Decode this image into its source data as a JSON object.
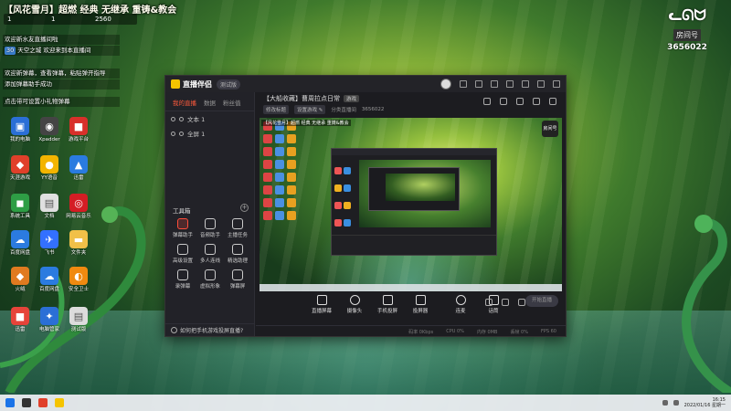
{
  "overlay": {
    "title": "【风花雪月】超燃 经典 无继承 重铸&教会",
    "stats": [
      "1",
      "1",
      "2560"
    ],
    "chat": [
      {
        "text": "欢迎新水友直播间啦",
        "badge": ""
      },
      {
        "text": "天空之城 欢迎来到本直播间",
        "badge": "30"
      },
      {
        "text": "欢迎新弹幕，查看弹幕，粘贴弹开指导",
        "badge": ""
      },
      {
        "text": "添加弹幕助手成功",
        "badge": ""
      },
      {
        "text": "点击带可设置小礼物弹幕",
        "badge": ""
      }
    ]
  },
  "room_logo": {
    "label": "房间号",
    "number": "3656022"
  },
  "desktop_icons": [
    {
      "label": "我的电脑",
      "color": "#2b6fd6",
      "glyph": "▣"
    },
    {
      "label": "Xpadder",
      "color": "#444444",
      "glyph": "◉"
    },
    {
      "label": "游戏平台",
      "color": "#d8302a",
      "glyph": "■"
    },
    {
      "label": "天涯游戏",
      "color": "#e0402a",
      "glyph": "◆"
    },
    {
      "label": "YY语音",
      "color": "#f3b400",
      "glyph": "●"
    },
    {
      "label": "迅雷",
      "color": "#2a7be0",
      "glyph": "▲"
    },
    {
      "label": "系统工具",
      "color": "#2e9e45",
      "glyph": "◼"
    },
    {
      "label": "文档",
      "color": "#e0e0e0",
      "glyph": "▤"
    },
    {
      "label": "网易云音乐",
      "color": "#d41d24",
      "glyph": "◎"
    },
    {
      "label": "百度网盘",
      "color": "#2b7be0",
      "glyph": "☁"
    },
    {
      "label": "飞书",
      "color": "#3370ff",
      "glyph": "✈"
    },
    {
      "label": "文件夹",
      "color": "#f1c048",
      "glyph": "▬"
    },
    {
      "label": "火绒",
      "color": "#e07a20",
      "glyph": "◆"
    },
    {
      "label": "百度网盘",
      "color": "#2b7be0",
      "glyph": "☁"
    },
    {
      "label": "安全卫士",
      "color": "#f08a10",
      "glyph": "◐"
    },
    {
      "label": "迅雷",
      "color": "#e6443a",
      "glyph": "■"
    },
    {
      "label": "电脑管家",
      "color": "#2b6fd6",
      "glyph": "✦"
    },
    {
      "label": "测试版",
      "color": "#dcdcdc",
      "glyph": "▤"
    }
  ],
  "app": {
    "name": "直播伴侣",
    "version": "测试版",
    "left_tabs": [
      "我的直播",
      "数据",
      "粉丝值"
    ],
    "scenes": [
      "文本 1",
      "全屏 1"
    ],
    "tools_title": "工具箱",
    "tools": [
      {
        "label": "弹幕助手",
        "red": true
      },
      {
        "label": "音频助手",
        "red": false
      },
      {
        "label": "主播任务",
        "red": false
      },
      {
        "label": "高级设置",
        "red": false
      },
      {
        "label": "多人连线",
        "red": false
      },
      {
        "label": "精选助理",
        "red": false
      },
      {
        "label": "录弹幕",
        "red": false
      },
      {
        "label": "虚拟形象",
        "red": false
      },
      {
        "label": "弹幕屏",
        "red": false
      }
    ],
    "footer_hint": "如何把手机游戏投屏直播?",
    "room_title": "【大船收藏】曹周拉点日常",
    "room_tag": "游戏",
    "room_sub": [
      "修改标题",
      "设置游戏 ✎",
      "分类直播间",
      "3656022"
    ],
    "controls": [
      "直播屏幕",
      "摄像头",
      "手机投屏",
      "投屏器",
      "连麦",
      "话筒"
    ],
    "start_label": "开始直播",
    "status": [
      "码率 0Kbps",
      "CPU 0%",
      "内存 0MB",
      "丢帧 0%",
      "FPS 60"
    ]
  },
  "preview": {
    "label": "【风花雪月】超燃 经典 无继承 重铸&教会",
    "logo": "房间号"
  },
  "taskbar": {
    "time": "16:15",
    "date": "2022/01/16 星期一"
  }
}
